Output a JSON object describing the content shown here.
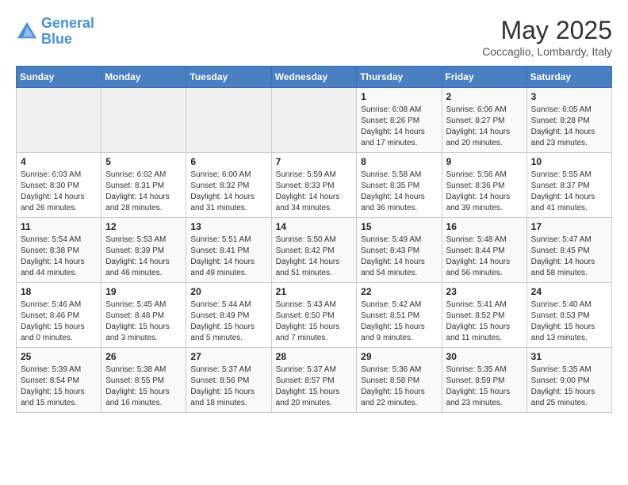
{
  "header": {
    "logo_line1": "General",
    "logo_line2": "Blue",
    "month": "May 2025",
    "location": "Coccaglio, Lombardy, Italy"
  },
  "days_of_week": [
    "Sunday",
    "Monday",
    "Tuesday",
    "Wednesday",
    "Thursday",
    "Friday",
    "Saturday"
  ],
  "weeks": [
    [
      {
        "day": "",
        "info": ""
      },
      {
        "day": "",
        "info": ""
      },
      {
        "day": "",
        "info": ""
      },
      {
        "day": "",
        "info": ""
      },
      {
        "day": "1",
        "info": "Sunrise: 6:08 AM\nSunset: 8:26 PM\nDaylight: 14 hours\nand 17 minutes."
      },
      {
        "day": "2",
        "info": "Sunrise: 6:06 AM\nSunset: 8:27 PM\nDaylight: 14 hours\nand 20 minutes."
      },
      {
        "day": "3",
        "info": "Sunrise: 6:05 AM\nSunset: 8:28 PM\nDaylight: 14 hours\nand 23 minutes."
      }
    ],
    [
      {
        "day": "4",
        "info": "Sunrise: 6:03 AM\nSunset: 8:30 PM\nDaylight: 14 hours\nand 26 minutes."
      },
      {
        "day": "5",
        "info": "Sunrise: 6:02 AM\nSunset: 8:31 PM\nDaylight: 14 hours\nand 28 minutes."
      },
      {
        "day": "6",
        "info": "Sunrise: 6:00 AM\nSunset: 8:32 PM\nDaylight: 14 hours\nand 31 minutes."
      },
      {
        "day": "7",
        "info": "Sunrise: 5:59 AM\nSunset: 8:33 PM\nDaylight: 14 hours\nand 34 minutes."
      },
      {
        "day": "8",
        "info": "Sunrise: 5:58 AM\nSunset: 8:35 PM\nDaylight: 14 hours\nand 36 minutes."
      },
      {
        "day": "9",
        "info": "Sunrise: 5:56 AM\nSunset: 8:36 PM\nDaylight: 14 hours\nand 39 minutes."
      },
      {
        "day": "10",
        "info": "Sunrise: 5:55 AM\nSunset: 8:37 PM\nDaylight: 14 hours\nand 41 minutes."
      }
    ],
    [
      {
        "day": "11",
        "info": "Sunrise: 5:54 AM\nSunset: 8:38 PM\nDaylight: 14 hours\nand 44 minutes."
      },
      {
        "day": "12",
        "info": "Sunrise: 5:53 AM\nSunset: 8:39 PM\nDaylight: 14 hours\nand 46 minutes."
      },
      {
        "day": "13",
        "info": "Sunrise: 5:51 AM\nSunset: 8:41 PM\nDaylight: 14 hours\nand 49 minutes."
      },
      {
        "day": "14",
        "info": "Sunrise: 5:50 AM\nSunset: 8:42 PM\nDaylight: 14 hours\nand 51 minutes."
      },
      {
        "day": "15",
        "info": "Sunrise: 5:49 AM\nSunset: 8:43 PM\nDaylight: 14 hours\nand 54 minutes."
      },
      {
        "day": "16",
        "info": "Sunrise: 5:48 AM\nSunset: 8:44 PM\nDaylight: 14 hours\nand 56 minutes."
      },
      {
        "day": "17",
        "info": "Sunrise: 5:47 AM\nSunset: 8:45 PM\nDaylight: 14 hours\nand 58 minutes."
      }
    ],
    [
      {
        "day": "18",
        "info": "Sunrise: 5:46 AM\nSunset: 8:46 PM\nDaylight: 15 hours\nand 0 minutes."
      },
      {
        "day": "19",
        "info": "Sunrise: 5:45 AM\nSunset: 8:48 PM\nDaylight: 15 hours\nand 3 minutes."
      },
      {
        "day": "20",
        "info": "Sunrise: 5:44 AM\nSunset: 8:49 PM\nDaylight: 15 hours\nand 5 minutes."
      },
      {
        "day": "21",
        "info": "Sunrise: 5:43 AM\nSunset: 8:50 PM\nDaylight: 15 hours\nand 7 minutes."
      },
      {
        "day": "22",
        "info": "Sunrise: 5:42 AM\nSunset: 8:51 PM\nDaylight: 15 hours\nand 9 minutes."
      },
      {
        "day": "23",
        "info": "Sunrise: 5:41 AM\nSunset: 8:52 PM\nDaylight: 15 hours\nand 11 minutes."
      },
      {
        "day": "24",
        "info": "Sunrise: 5:40 AM\nSunset: 8:53 PM\nDaylight: 15 hours\nand 13 minutes."
      }
    ],
    [
      {
        "day": "25",
        "info": "Sunrise: 5:39 AM\nSunset: 8:54 PM\nDaylight: 15 hours\nand 15 minutes."
      },
      {
        "day": "26",
        "info": "Sunrise: 5:38 AM\nSunset: 8:55 PM\nDaylight: 15 hours\nand 16 minutes."
      },
      {
        "day": "27",
        "info": "Sunrise: 5:37 AM\nSunset: 8:56 PM\nDaylight: 15 hours\nand 18 minutes."
      },
      {
        "day": "28",
        "info": "Sunrise: 5:37 AM\nSunset: 8:57 PM\nDaylight: 15 hours\nand 20 minutes."
      },
      {
        "day": "29",
        "info": "Sunrise: 5:36 AM\nSunset: 8:58 PM\nDaylight: 15 hours\nand 22 minutes."
      },
      {
        "day": "30",
        "info": "Sunrise: 5:35 AM\nSunset: 8:59 PM\nDaylight: 15 hours\nand 23 minutes."
      },
      {
        "day": "31",
        "info": "Sunrise: 5:35 AM\nSunset: 9:00 PM\nDaylight: 15 hours\nand 25 minutes."
      }
    ]
  ]
}
